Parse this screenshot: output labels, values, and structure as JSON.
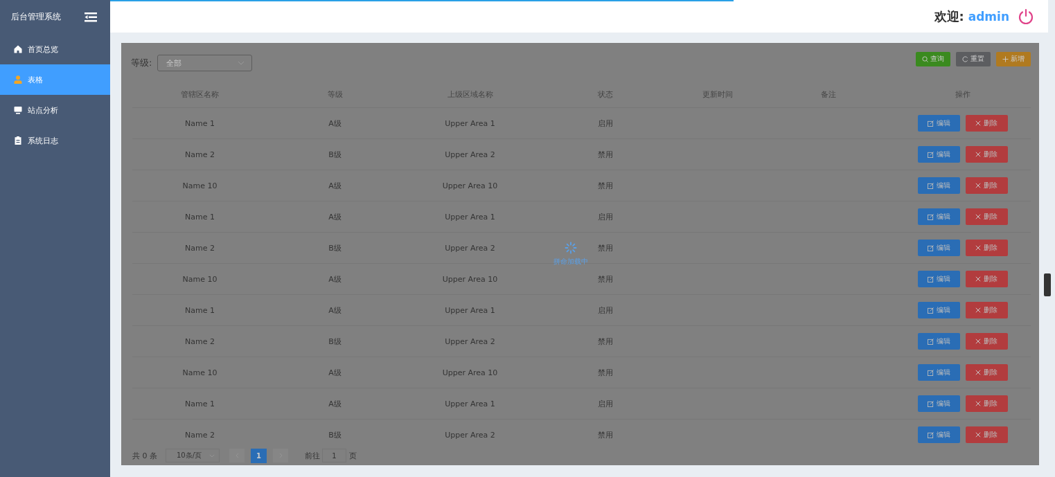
{
  "top_progress": {
    "level": 0.66
  },
  "sidebar": {
    "title": "后台管理系统",
    "items": [
      {
        "label": "首页总览",
        "selected": false
      },
      {
        "label": "表格",
        "selected": true
      },
      {
        "label": "站点分析",
        "selected": false
      },
      {
        "label": "系统日志",
        "selected": false
      }
    ]
  },
  "header": {
    "welcome": "欢迎:",
    "user": "admin"
  },
  "filter": {
    "label": "等级:",
    "placeholder": "全部"
  },
  "buttons": [
    {
      "kind": "search",
      "label": "查询"
    },
    {
      "kind": "reset",
      "label": "重置"
    },
    {
      "kind": "add",
      "label": "新增"
    }
  ],
  "table": {
    "columns": [
      "管辖区名称",
      "等级",
      "上级区域名称",
      "状态",
      "更新时间",
      "备注",
      "操作"
    ],
    "rows": [
      {
        "name": "Name 1",
        "level": "A级",
        "upper_area": "Upper Area 1",
        "status": "启用",
        "edit": "编辑",
        "delete": "删除"
      },
      {
        "name": "Name 2",
        "level": "B级",
        "upper_area": "Upper Area 2",
        "status": "禁用",
        "edit": "编辑",
        "delete": "删除"
      },
      {
        "name": "Name 10",
        "level": "A级",
        "upper_area": "Upper Area 10",
        "status": "禁用",
        "edit": "编辑",
        "delete": "删除"
      },
      {
        "name": "Name 1",
        "level": "A级",
        "upper_area": "Upper Area 1",
        "status": "启用",
        "edit": "编辑",
        "delete": "删除"
      },
      {
        "name": "Name 2",
        "level": "B级",
        "upper_area": "Upper Area 2",
        "status": "禁用",
        "edit": "编辑",
        "delete": "删除"
      },
      {
        "name": "Name 10",
        "level": "A级",
        "upper_area": "Upper Area 10",
        "status": "禁用",
        "edit": "编辑",
        "delete": "删除"
      },
      {
        "name": "Name 1",
        "level": "A级",
        "upper_area": "Upper Area 1",
        "status": "启用",
        "edit": "编辑",
        "delete": "删除"
      },
      {
        "name": "Name 2",
        "level": "B级",
        "upper_area": "Upper Area 2",
        "status": "禁用",
        "edit": "编辑",
        "delete": "删除"
      },
      {
        "name": "Name 10",
        "level": "A级",
        "upper_area": "Upper Area 10",
        "status": "禁用",
        "edit": "编辑",
        "delete": "删除"
      },
      {
        "name": "Name 1",
        "level": "A级",
        "upper_area": "Upper Area 1",
        "status": "启用",
        "edit": "编辑",
        "delete": "删除"
      },
      {
        "name": "Name 2",
        "level": "B级",
        "upper_area": "Upper Area 2",
        "status": "禁用",
        "edit": "编辑",
        "delete": "删除"
      }
    ]
  },
  "pagination": {
    "total": "共 0 条",
    "page_size": "10条/页",
    "pages": [
      {
        "label": "1",
        "selected": true
      }
    ],
    "goto_label": "前往",
    "goto_value": "1",
    "goto_unit": "页"
  },
  "loading": {
    "text": "拼命加载中"
  }
}
